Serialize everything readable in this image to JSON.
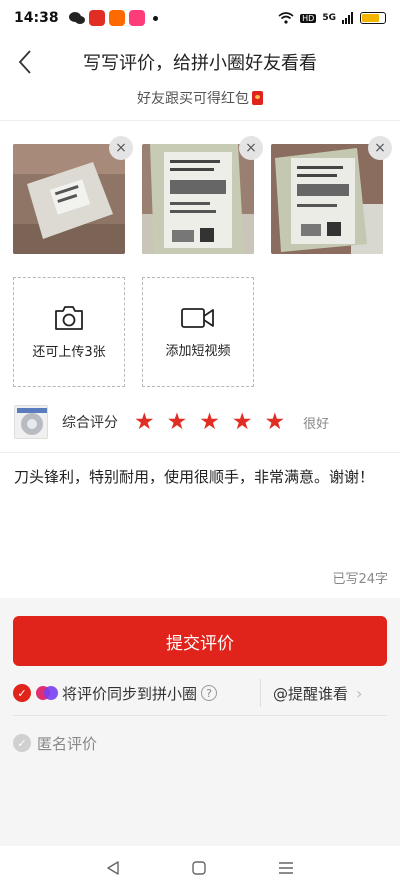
{
  "status_bar": {
    "time": "14:38",
    "network": "5G",
    "hd": "HD",
    "battery_level": 0.7,
    "icons": [
      "wechat-icon",
      "pinduoduo-icon",
      "taobao-icon",
      "app-icon",
      "dot-icon",
      "wifi-icon",
      "signal-icon",
      "battery-icon"
    ]
  },
  "header": {
    "title": "写写评价，给拼小圈好友看看",
    "subtitle": "好友跟买可得红包"
  },
  "media": {
    "remove_label": "×",
    "upload_photo_label": "还可上传3张",
    "add_video_label": "添加短视频"
  },
  "rating": {
    "label": "综合评分",
    "stars": 5,
    "max_stars": 5,
    "star_glyph": "★",
    "text": "很好"
  },
  "review": {
    "content": "刀头锋利，特别耐用，使用很顺手，非常满意。谢谢！",
    "char_count": "已写24字"
  },
  "actions": {
    "submit_label": "提交评价",
    "sync_label": "将评价同步到拼小圈",
    "sync_checked": true,
    "help_label": "?",
    "mention_label": "@提醒谁看",
    "anonymous_label": "匿名评价",
    "anonymous_checked": false
  },
  "colors": {
    "accent": "#e0231b",
    "star": "#e02e24",
    "panel_bg": "#f5f5f5"
  }
}
